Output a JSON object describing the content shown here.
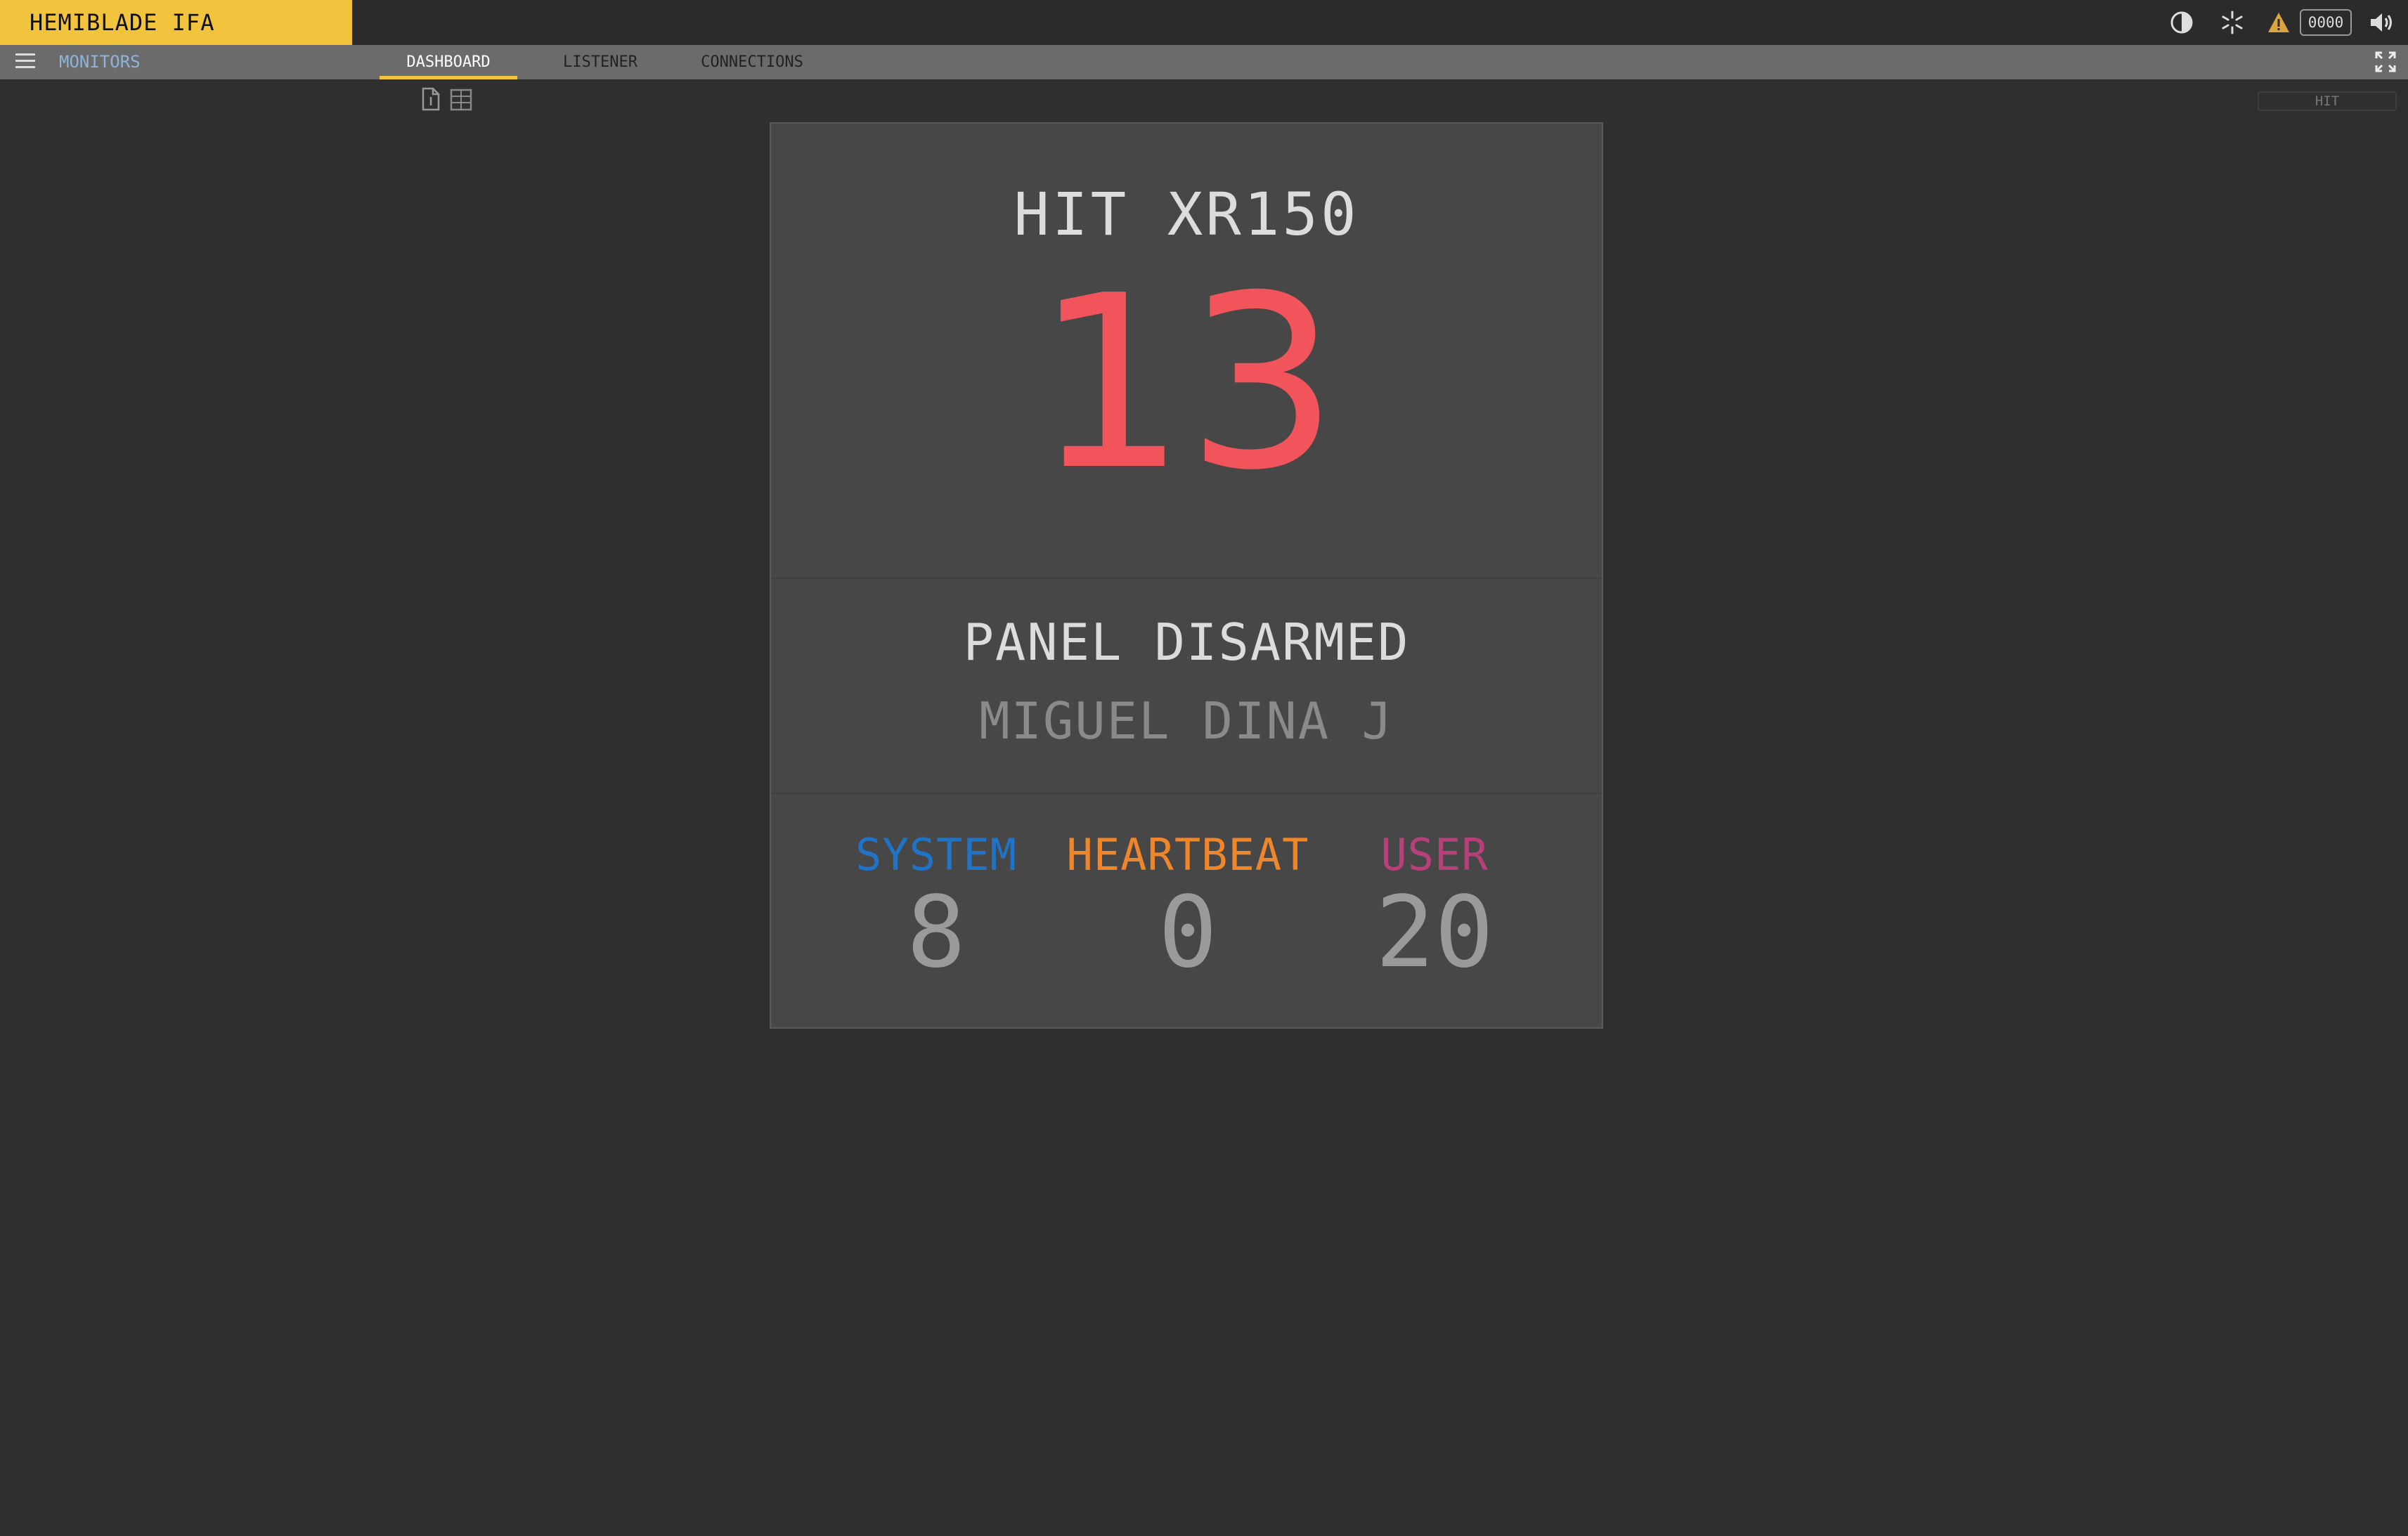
{
  "app": {
    "title": "HEMIBLADE IFA"
  },
  "header": {
    "counter": "0000"
  },
  "nav": {
    "monitors_label": "MONITORS",
    "tabs": [
      {
        "label": "DASHBOARD",
        "active": true
      },
      {
        "label": "LISTENER",
        "active": false
      },
      {
        "label": "CONNECTIONS",
        "active": false
      }
    ]
  },
  "filter": {
    "placeholder": "HIT"
  },
  "card": {
    "model": "HIT XR150",
    "number": "13",
    "status": "PANEL DISARMED",
    "user": "MIGUEL DINA J",
    "stats": [
      {
        "label": "SYSTEM",
        "value": "8",
        "color": "#1f74c8"
      },
      {
        "label": "HEARTBEAT",
        "value": "0",
        "color": "#f0862a"
      },
      {
        "label": "USER",
        "value": "20",
        "color": "#b8407a"
      }
    ]
  },
  "icons": [
    "contrast-icon",
    "snowflake-icon",
    "warning-icon",
    "volume-icon",
    "menu-icon",
    "fullscreen-icon",
    "document-icon",
    "grid-icon"
  ],
  "colors": {
    "brand": "#f2c43d",
    "alert": "#f2545b",
    "background": "#2f2f2f",
    "card": "#474747"
  }
}
